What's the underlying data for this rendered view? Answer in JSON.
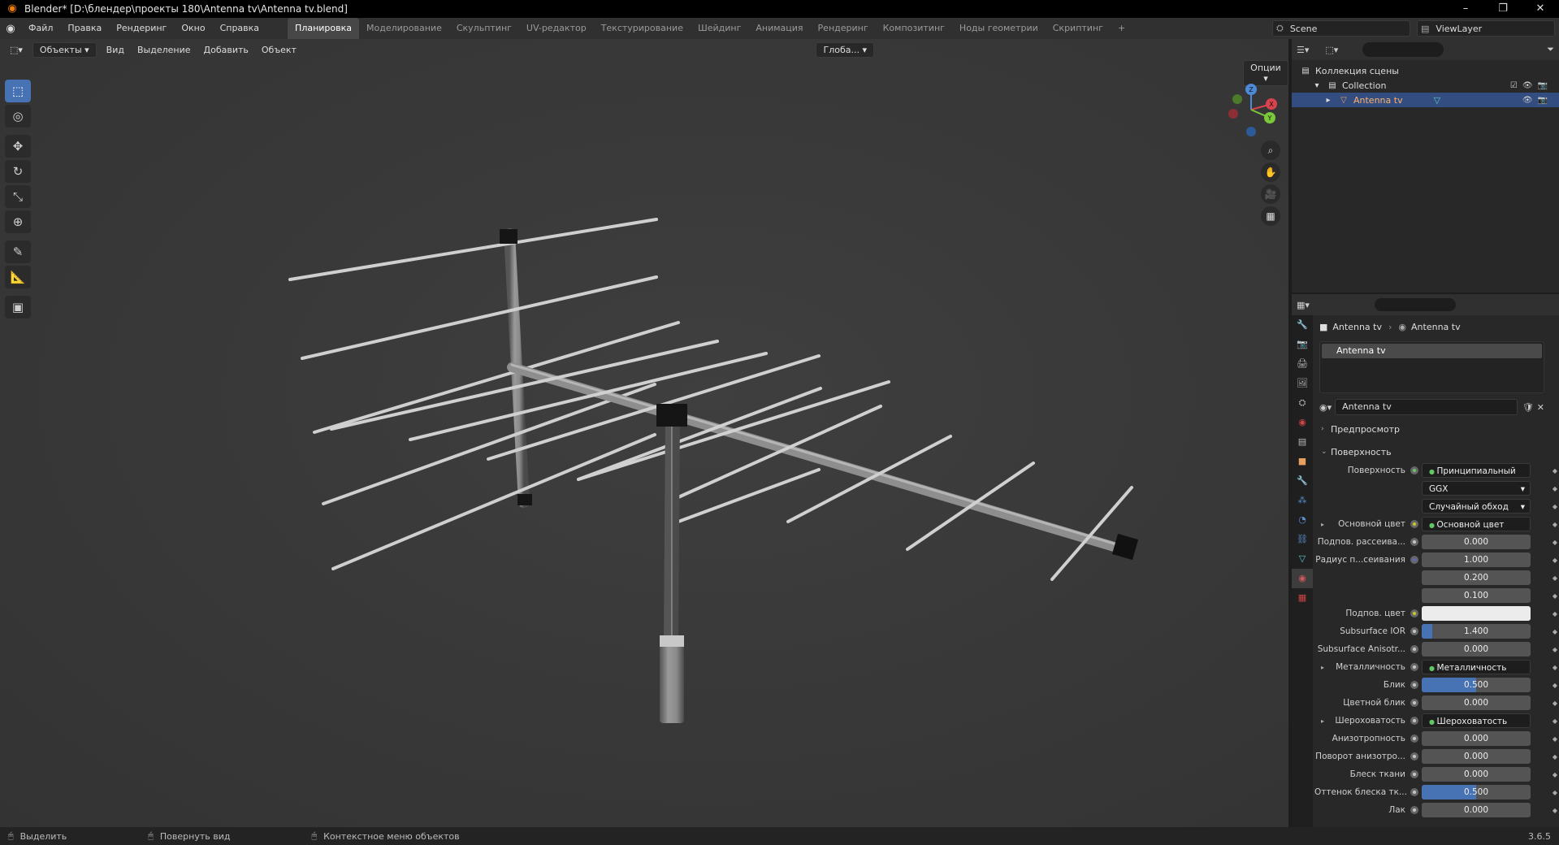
{
  "window": {
    "title": "Blender* [D:\\блендер\\проекты 180\\Antenna tv\\Antenna tv.blend]",
    "minimize": "–",
    "maximize": "❐",
    "close": "✕"
  },
  "menu": {
    "items": [
      "Файл",
      "Правка",
      "Рендеринг",
      "Окно",
      "Справка"
    ],
    "workspaces": [
      "Планировка",
      "Моделирование",
      "Скульптинг",
      "UV-редактор",
      "Текстурирование",
      "Шейдинг",
      "Анимация",
      "Рендеринг",
      "Композитинг",
      "Ноды геометрии",
      "Скриптинг"
    ],
    "active_workspace": "Планировка",
    "add_workspace": "+",
    "scene": "Scene",
    "view_layer": "ViewLayer"
  },
  "viewport_header": {
    "mode": "Объекты",
    "menus": [
      "Вид",
      "Выделение",
      "Добавить",
      "Объект"
    ],
    "orientation": "Глоба...",
    "options": "Опции"
  },
  "outliner": {
    "scene_collection": "Коллекция сцены",
    "collection": "Collection",
    "object": "Antenna tv"
  },
  "properties": {
    "breadcrumb_object": "Antenna tv",
    "breadcrumb_material": "Antenna tv",
    "slot_name": "Antenna tv",
    "material_name": "Antenna tv",
    "sections": {
      "preview": "Предпросмотр",
      "surface": "Поверхность"
    },
    "rows": [
      {
        "label": "Поверхность",
        "value": "Принципиальный BSDF",
        "type": "link",
        "socket": "g"
      },
      {
        "label": "",
        "value": "GGX",
        "type": "dropdown"
      },
      {
        "label": "",
        "value": "Случайный обход",
        "type": "dropdown"
      },
      {
        "label": "Основной цвет",
        "value": "Основной цвет",
        "type": "link",
        "socket": "y",
        "expand": true
      },
      {
        "label": "Подпов. рассеива...",
        "value": "0.000",
        "type": "num",
        "socket": "n"
      },
      {
        "label": "Радиус п...сеивания",
        "value": "1.000",
        "type": "num",
        "socket": "b"
      },
      {
        "label": "",
        "value": "0.200",
        "type": "num"
      },
      {
        "label": "",
        "value": "0.100",
        "type": "num"
      },
      {
        "label": "Подпов. цвет",
        "value": "",
        "type": "color",
        "socket": "y"
      },
      {
        "label": "Subsurface IOR",
        "value": "1.400",
        "type": "num",
        "socket": "n",
        "fill": 0.1
      },
      {
        "label": "Subsurface Anisotr...",
        "value": "0.000",
        "type": "num",
        "socket": "n"
      },
      {
        "label": "Металличность",
        "value": "Металличность",
        "type": "link",
        "socket": "n",
        "expand": true
      },
      {
        "label": "Блик",
        "value": "0.500",
        "type": "num",
        "socket": "n",
        "fill": 0.5
      },
      {
        "label": "Цветной блик",
        "value": "0.000",
        "type": "num",
        "socket": "n"
      },
      {
        "label": "Шероховатость",
        "value": "Шероховатость",
        "type": "link",
        "socket": "n",
        "expand": true
      },
      {
        "label": "Анизотропность",
        "value": "0.000",
        "type": "num",
        "socket": "n"
      },
      {
        "label": "Поворот анизотро...",
        "value": "0.000",
        "type": "num",
        "socket": "n"
      },
      {
        "label": "Блеск ткани",
        "value": "0.000",
        "type": "num",
        "socket": "n"
      },
      {
        "label": "Оттенок блеска тк...",
        "value": "0.500",
        "type": "num",
        "socket": "n",
        "fill": 0.5
      },
      {
        "label": "Лак",
        "value": "0.000",
        "type": "num",
        "socket": "n"
      }
    ]
  },
  "statusbar": {
    "select": "Выделить",
    "rotate": "Повернуть вид",
    "context": "Контекстное меню объектов",
    "version": "3.6.5"
  },
  "gizmo": {
    "x": "X",
    "y": "Y",
    "z": "Z"
  },
  "colors": {
    "accent": "#4772b3",
    "brand": "#e87d0d",
    "selection": "#334d80"
  }
}
